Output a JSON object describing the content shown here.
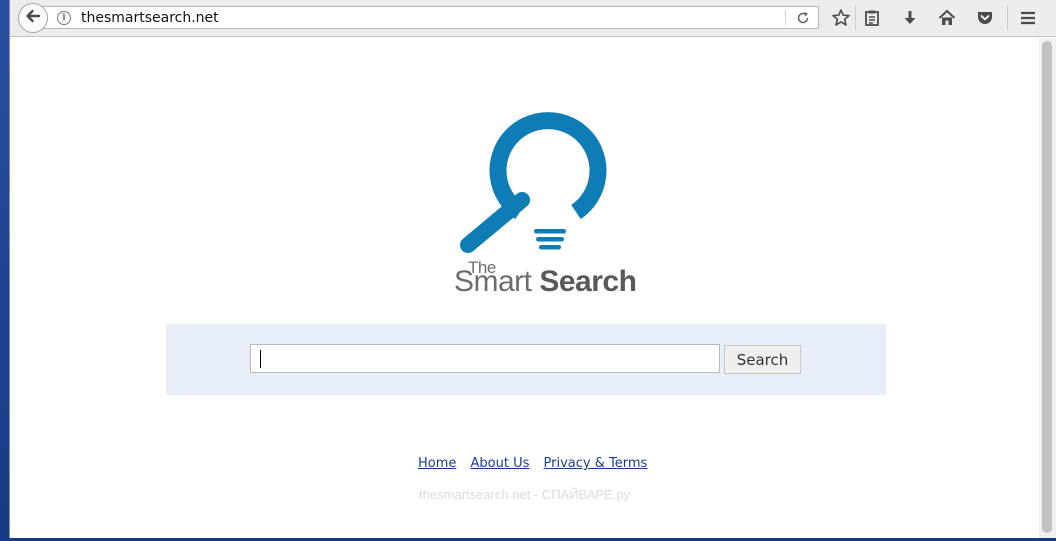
{
  "browser": {
    "url": "thesmartsearch.net",
    "icons": [
      "back-arrow-icon",
      "info-icon",
      "reload-icon",
      "bookmark-star-icon",
      "reading-list-icon",
      "download-icon",
      "home-icon",
      "pocket-icon",
      "hamburger-menu-icon"
    ]
  },
  "logo": {
    "line1": "The",
    "line2_light": "Smart",
    "line2_bold": "Search",
    "brand_color": "#0f7db5",
    "text_color": "#6d6e71"
  },
  "search": {
    "input_value": "",
    "button_label": "Search",
    "panel_color": "#e8eef8"
  },
  "footer": {
    "links": [
      "Home",
      "About Us",
      "Privacy & Terms"
    ],
    "link_color": "#1a3d8f"
  },
  "watermark": "thesmartsearch.net - СПАЙВАРЕ.ру"
}
